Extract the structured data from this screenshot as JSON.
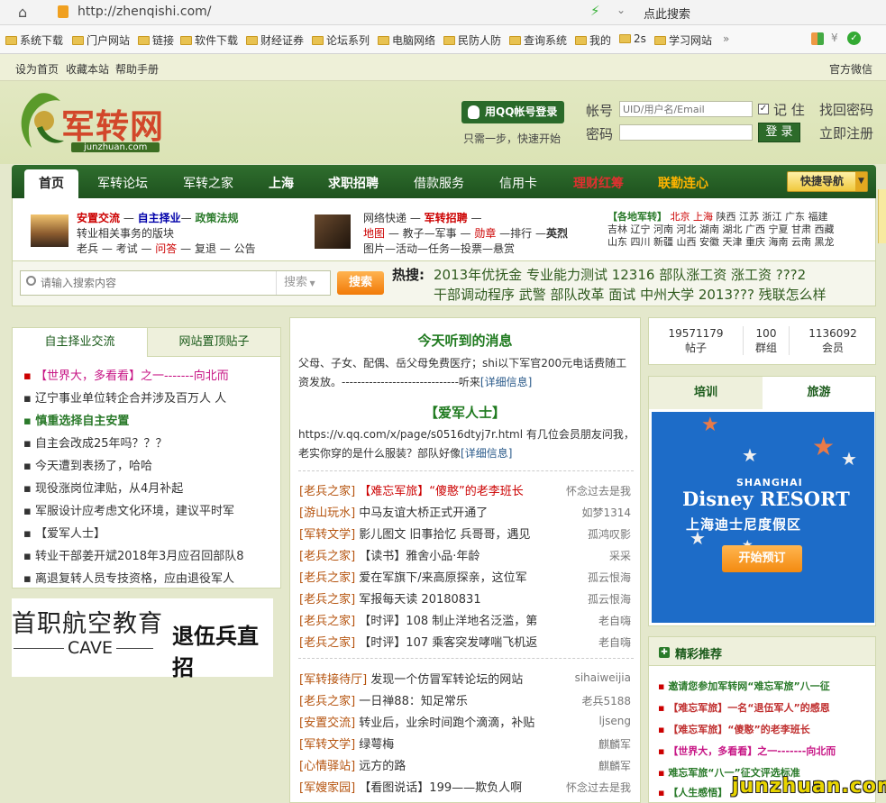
{
  "browser": {
    "url": "http://zhenqishi.com/",
    "search_label": "点此搜索"
  },
  "bookmarks": [
    "系统下载",
    "门户网站",
    "链接",
    "软件下载",
    "财经证券",
    "论坛系列",
    "电脑网络",
    "民防人防",
    "查询系统",
    "我的",
    "2s",
    "学习网站"
  ],
  "topbar": {
    "home": "设为首页",
    "fav": "收藏本站",
    "help": "帮助手册",
    "wechat": "官方微信"
  },
  "logo": {
    "name": "军转网",
    "url": "junzhuan.com"
  },
  "login": {
    "qq": "用QQ帐号登录",
    "qq_sub": "只需一步，快速开始",
    "user_label": "帐号",
    "user_ph": "UID/用户名/Email",
    "remember": "记 住",
    "find_pw": "找回密码",
    "pw_label": "密码",
    "login_btn": "登 录",
    "register": "立即注册"
  },
  "nav": [
    "首页",
    "军转论坛",
    "军转之家",
    "上海",
    "求职招聘",
    "借款服务",
    "信用卡",
    "理财红筹",
    "联勤连心"
  ],
  "nav_quick": "快捷导航",
  "sub1": {
    "l1a": "安置交流",
    "l1b": "自主择业",
    "l1c": "政策法规",
    "l2": "转业相关事务的版块",
    "l3a": "老兵 — 考试 —",
    "l3b": "问答",
    "l3c": "— 复退 — 公告"
  },
  "sub2": {
    "l1a": "网络快递 —",
    "l1b": "军转招聘",
    "l1c": "—",
    "l2a": "地图",
    "l2b": "— 教子—军事 —",
    "l2c": "勋章",
    "l2d": "—排行 —",
    "l2e": "英烈",
    "l3": "图片—活动—任务—投票—悬赏"
  },
  "sub3": {
    "l1a": "【各地军转】",
    "l1b": "北京 上海",
    "l1c": "陕西 江苏 浙江 广东 福建",
    "l2": "吉林 辽宁 河南 河北 湖南 湖北 广西 宁夏 甘肃 西藏",
    "l3": "山东 四川 新疆 山西 安徽 天津 重庆 海南 云南 黑龙"
  },
  "search": {
    "placeholder": "请输入搜索内容",
    "type": "搜索",
    "btn": "搜索",
    "hot_label": "热搜:",
    "hot1": "2013年优抚金 专业能力测试 12316 部队涨工资 涨工资 ???2",
    "hot2": "干部调动程序 武警 部队改革 面试 中州大学 2013??? 残联怎么样"
  },
  "left": {
    "tab1": "自主择业交流",
    "tab2": "网站置顶贴子",
    "items": [
      "【世界大，多看看】之一-------向北而",
      "辽宁事业单位转企合并涉及百万人 人",
      "慎重选择自主安置",
      "自主会改成25年吗？？？",
      "今天遭到表扬了，哈哈",
      "现役涨岗位津贴，从4月补起",
      "军服设计应考虑文化环境，建议平时军",
      "【爱军人士】",
      "转业干部姜开斌2018年3月应召回部队8",
      "离退复转人员专技资格，应由退役军人"
    ],
    "ad_title": "首职航空教育",
    "ad_sub": "CAVE",
    "ad_side": "退伍兵直招"
  },
  "middle": {
    "news_title": "今天听到的消息",
    "news_text": "父母、子女、配偶、岳父母免费医疗；shi以下军官200元电话费随工资发放。------------------------------听来",
    "detail": "[详细信息]",
    "love_title": "【爱军人士】",
    "love_text": "https://v.qq.com/x/page/s0516dtyj7r.html 有几位会员朋友问我，老实你穿的是什么服装？部队好像",
    "list1": [
      {
        "cat": "[老兵之家]",
        "title": "【难忘军旅】“傻憨”的老李班长",
        "author": "怀念过去是我"
      },
      {
        "cat": "[游山玩水]",
        "title": "中马友谊大桥正式开通了",
        "author": "如梦1314"
      },
      {
        "cat": "[军转文学]",
        "title": "影儿图文 旧事拾忆 兵哥哥，遇见",
        "author": "孤鸿叹影"
      },
      {
        "cat": "[老兵之家]",
        "title": "【读书】雅舍小品·年龄",
        "author": "采采"
      },
      {
        "cat": "[老兵之家]",
        "title": "爱在军旗下/来高原探亲，这位军",
        "author": "孤云恨海"
      },
      {
        "cat": "[老兵之家]",
        "title": "军报每天读 20180831",
        "author": "孤云恨海"
      },
      {
        "cat": "[老兵之家]",
        "title": "【时评】108 制止洋地名泛滥，第",
        "author": "老自嗨"
      },
      {
        "cat": "[老兵之家]",
        "title": "【时评】107 乘客突发哮喘飞机返",
        "author": "老自嗨"
      }
    ],
    "list2": [
      {
        "cat": "[军转接待厅]",
        "title": "发现一个仿冒军转论坛的网站",
        "author": "sihaiweijia"
      },
      {
        "cat": "[老兵之家]",
        "title": "一日禅88：知足常乐",
        "author": "老兵5188"
      },
      {
        "cat": "[安置交流]",
        "title": "转业后，业余时间跑个滴滴，补贴",
        "author": "ljseng"
      },
      {
        "cat": "[军转文学]",
        "title": "绿萼梅",
        "author": "麒麟军"
      },
      {
        "cat": "[心情驿站]",
        "title": "远方的路",
        "author": "麒麟军"
      },
      {
        "cat": "[军嫂家园]",
        "title": "【看图说话】199——欺负人啊",
        "author": "怀念过去是我"
      }
    ]
  },
  "stats": [
    {
      "num": "19571179",
      "label": "帖子"
    },
    {
      "num": "100",
      "label": "群组"
    },
    {
      "num": "1136092",
      "label": "会员"
    }
  ],
  "right": {
    "tab1": "培训",
    "tab2": "旅游",
    "ad_brand": "SHANGHAI",
    "ad_logo": "Disney RESORT",
    "ad_cn": "上海迪士尼度假区",
    "ad_btn": "开始预订",
    "rec_title": "精彩推荐",
    "rec": [
      "邀请您参加军转网“难忘军旅”八一征",
      "【难忘军旅】一名“退伍军人”的感恩",
      "【难忘军旅】“傻憨”的老李班长",
      "【世界大，多看看】之一-------向北而",
      "难忘军旅“八一”征文评选标准",
      "【人生感悟】"
    ]
  },
  "watermark": "junzhuan.com"
}
